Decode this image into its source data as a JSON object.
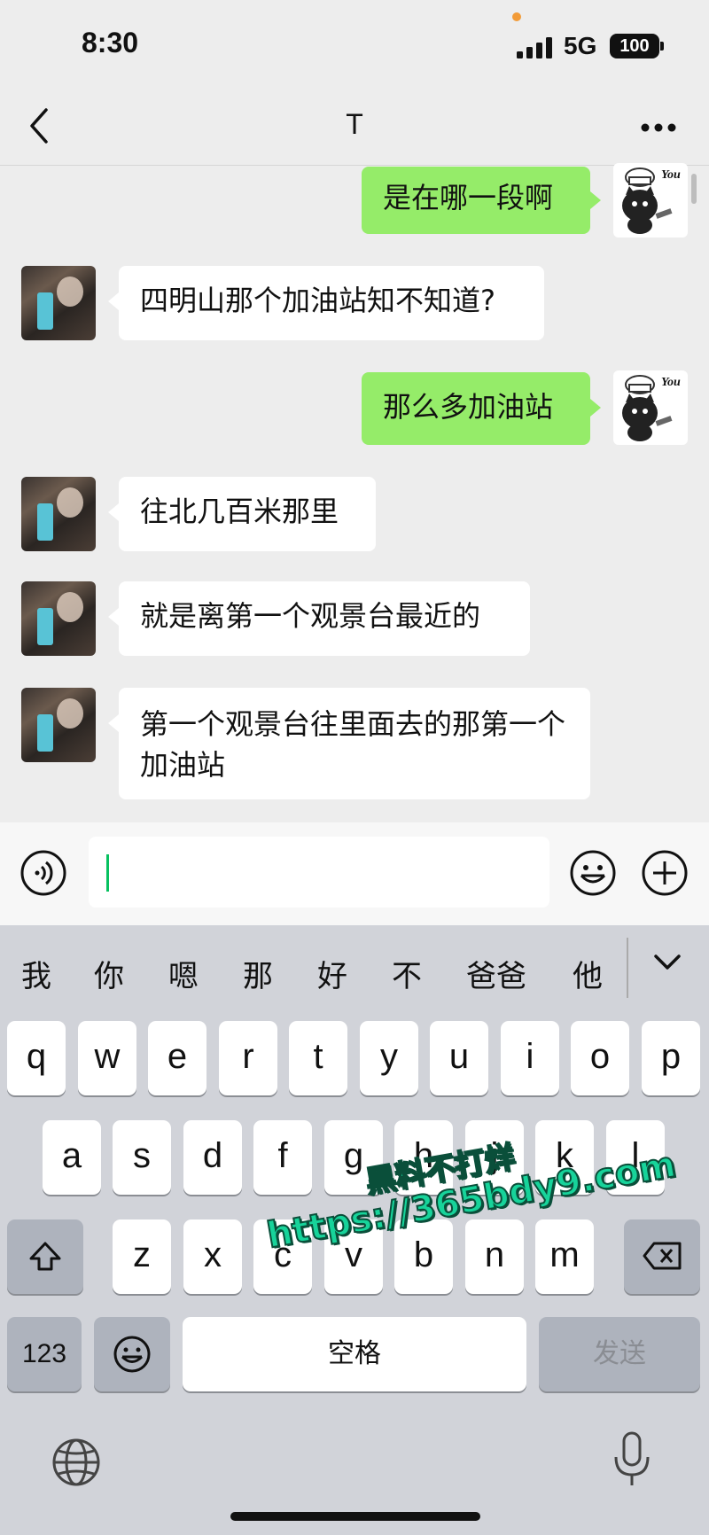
{
  "status_bar": {
    "time": "8:30",
    "network": "5G",
    "battery": "100"
  },
  "nav": {
    "title": "T"
  },
  "messages": [
    {
      "from": "me",
      "text": "是在哪一段啊"
    },
    {
      "from": "them",
      "text": "四明山那个加油站知不知道?"
    },
    {
      "from": "me",
      "text": "那么多加油站"
    },
    {
      "from": "them",
      "text": "往北几百米那里"
    },
    {
      "from": "them",
      "text": "就是离第一个观景台最近的"
    },
    {
      "from": "them",
      "text": "第一个观景台往里面去的那第一个加油站"
    }
  ],
  "my_avatar_label": "You",
  "candidates": [
    "我",
    "你",
    "嗯",
    "那",
    "好",
    "不",
    "爸爸",
    "他"
  ],
  "keyboard": {
    "row1": [
      "q",
      "w",
      "e",
      "r",
      "t",
      "y",
      "u",
      "i",
      "o",
      "p"
    ],
    "row2": [
      "a",
      "s",
      "d",
      "f",
      "g",
      "h",
      "j",
      "k",
      "l"
    ],
    "row3": [
      "z",
      "x",
      "c",
      "v",
      "b",
      "n",
      "m"
    ],
    "num_key": "123",
    "space": "空格",
    "send": "发送"
  },
  "watermark": {
    "line1": "黑料不打烊",
    "line2": "https://365bdy9.com"
  },
  "colors": {
    "my_bubble": "#95ec69",
    "their_bubble": "#ffffff",
    "chat_bg": "#ededed",
    "keyboard_bg": "#d1d3d9"
  }
}
